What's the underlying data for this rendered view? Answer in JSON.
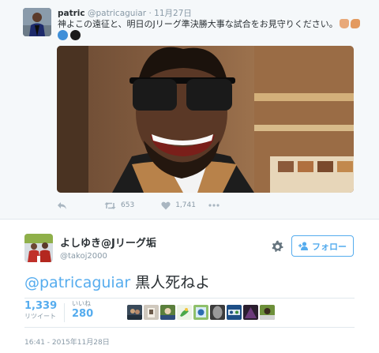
{
  "parent_tweet": {
    "name": "patric",
    "handle": "@patricaguiar",
    "separator": "·",
    "date": "11月27日",
    "text": "神よこの遠征と、明日のJリーグ準決勝大事な試合をお見守りください。",
    "emojis": [
      "folded-hands-icon",
      "clapping-hands-icon"
    ],
    "circle_colors": [
      "#3f8fd8",
      "#1b1b1b"
    ],
    "actions": {
      "retweet_count": "653",
      "like_count": "1,741"
    }
  },
  "main_tweet": {
    "name": "よしゆき@Jリーグ垢",
    "handle": "@takoj2000",
    "follow_label": "フォロー",
    "mention": "@patricaguiar",
    "text_rest": " 黒人死ねよ",
    "retweets": {
      "count": "1,339",
      "label": "リツイート"
    },
    "likes": {
      "count": "280",
      "label": "いいね"
    },
    "liker_count": 9,
    "timestamp": "16:41 - 2015年11月28日"
  },
  "colors": {
    "accent": "#55acee",
    "muted": "#8899a6",
    "text": "#292f33",
    "parent_bg": "#f5f8fa"
  }
}
